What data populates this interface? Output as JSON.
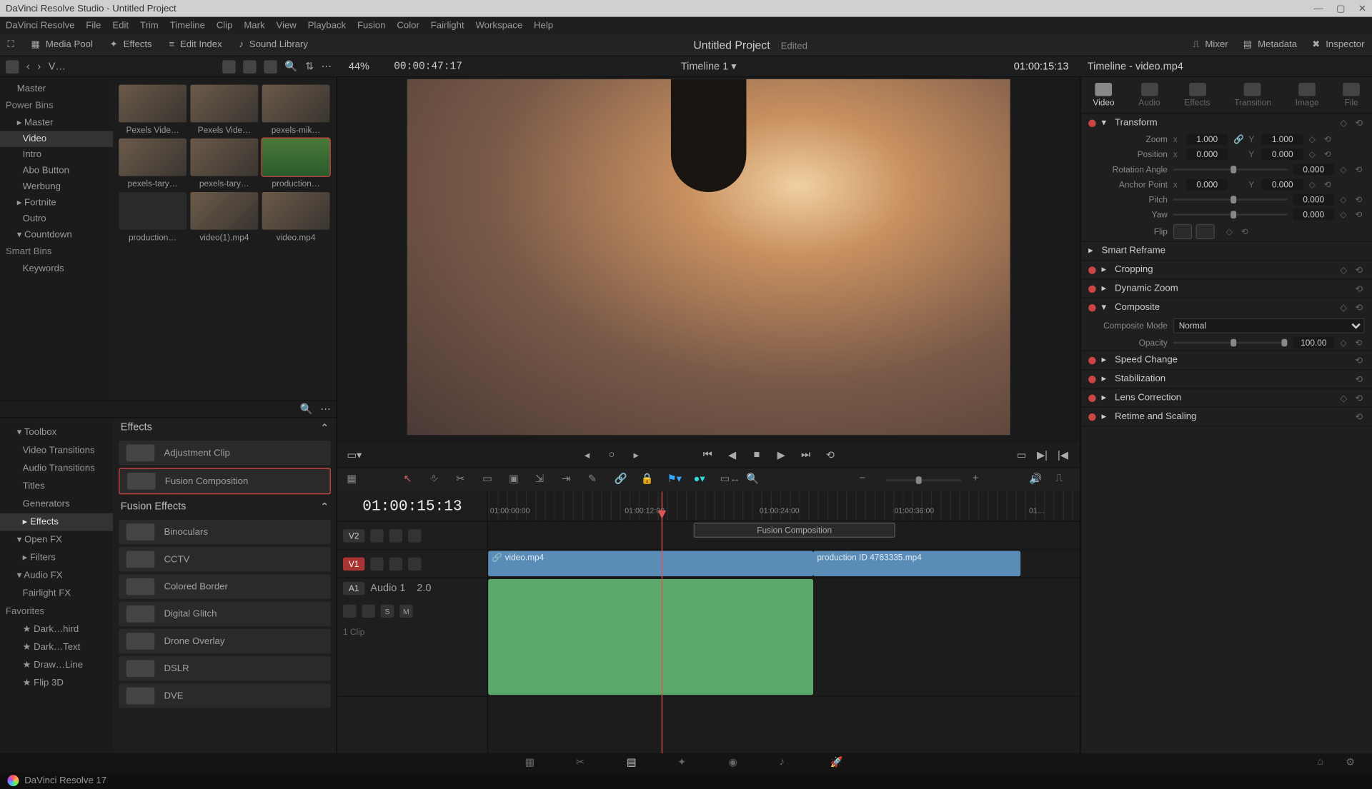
{
  "titlebar": {
    "text": "DaVinci Resolve Studio - Untitled Project"
  },
  "menubar": [
    "DaVinci Resolve",
    "File",
    "Edit",
    "Trim",
    "Timeline",
    "Clip",
    "Mark",
    "View",
    "Playback",
    "Fusion",
    "Color",
    "Fairlight",
    "Workspace",
    "Help"
  ],
  "toolbar": {
    "left": [
      "Media Pool",
      "Effects",
      "Edit Index",
      "Sound Library"
    ],
    "project": "Untitled Project",
    "edited": "Edited",
    "right": [
      "Mixer",
      "Metadata",
      "Inspector"
    ]
  },
  "strip2": {
    "v_lbl": "V…",
    "zoom_pct": "44%",
    "src_tc": "00:00:47:17",
    "timeline_name": "Timeline 1",
    "timeline_tc": "01:00:15:13",
    "clip_name": "Timeline - video.mp4"
  },
  "bins": {
    "master": "Master",
    "power_bins_hdr": "Power Bins",
    "tree": [
      "Master",
      "Video",
      "Intro",
      "Abo Button",
      "Werbung",
      "Fortnite",
      "Outro",
      "Countdown"
    ],
    "smart_bins_hdr": "Smart Bins",
    "smart": [
      "Keywords"
    ]
  },
  "thumbs": [
    "Pexels Vide…",
    "Pexels Vide…",
    "pexels-mik…",
    "pexels-tary…",
    "pexels-tary…",
    "production…",
    "production…",
    "video(1).mp4",
    "video.mp4"
  ],
  "fx_tree": {
    "toolbox": "Toolbox",
    "items": [
      "Video Transitions",
      "Audio Transitions",
      "Titles",
      "Generators",
      "Effects"
    ],
    "openfx": "Open FX",
    "ofx_items": [
      "Filters"
    ],
    "audiofx": "Audio FX",
    "afx_items": [
      "Fairlight FX"
    ],
    "favorites": "Favorites",
    "fav_items": [
      "Dark…hird",
      "Dark…Text",
      "Draw…Line",
      "Flip 3D"
    ]
  },
  "fx_list": {
    "effects_hdr": "Effects",
    "effects": [
      "Adjustment Clip",
      "Fusion Composition"
    ],
    "fusion_hdr": "Fusion Effects",
    "fusion": [
      "Binoculars",
      "CCTV",
      "Colored Border",
      "Digital Glitch",
      "Drone Overlay",
      "DSLR",
      "DVE"
    ]
  },
  "transport_tc": "01:00:15:13",
  "ruler": [
    "01:00:00:00",
    "01:00:12:00",
    "01:00:24:00",
    "01:00:36:00",
    "01…"
  ],
  "tracks": {
    "v2": "V2",
    "v1": "V1",
    "a1": "A1",
    "a1_name": "Audio 1",
    "a1_vol": "2.0",
    "a1_clips": "1 Clip",
    "s": "S",
    "m": "M"
  },
  "clips": {
    "fusion": "Fusion Composition",
    "v1a": "video.mp4",
    "v1b": "production ID 4763335.mp4"
  },
  "inspector": {
    "tabs": [
      "Video",
      "Audio",
      "Effects",
      "Transition",
      "Image",
      "File"
    ],
    "transform_hdr": "Transform",
    "zoom_lbl": "Zoom",
    "zoom_x": "1.000",
    "zoom_y": "1.000",
    "position_lbl": "Position",
    "pos_x": "0.000",
    "pos_y": "0.000",
    "rotation_lbl": "Rotation Angle",
    "rotation": "0.000",
    "anchor_lbl": "Anchor Point",
    "anc_x": "0.000",
    "anc_y": "0.000",
    "pitch_lbl": "Pitch",
    "pitch": "0.000",
    "yaw_lbl": "Yaw",
    "yaw": "0.000",
    "flip_lbl": "Flip",
    "smart_reframe": "Smart Reframe",
    "cropping": "Cropping",
    "dynamic_zoom": "Dynamic Zoom",
    "composite": "Composite",
    "composite_mode_lbl": "Composite Mode",
    "composite_mode": "Normal",
    "opacity_lbl": "Opacity",
    "opacity": "100.00",
    "speed_change": "Speed Change",
    "stabilization": "Stabilization",
    "lens_correction": "Lens Correction",
    "retime": "Retime and Scaling"
  },
  "status": "DaVinci Resolve 17"
}
